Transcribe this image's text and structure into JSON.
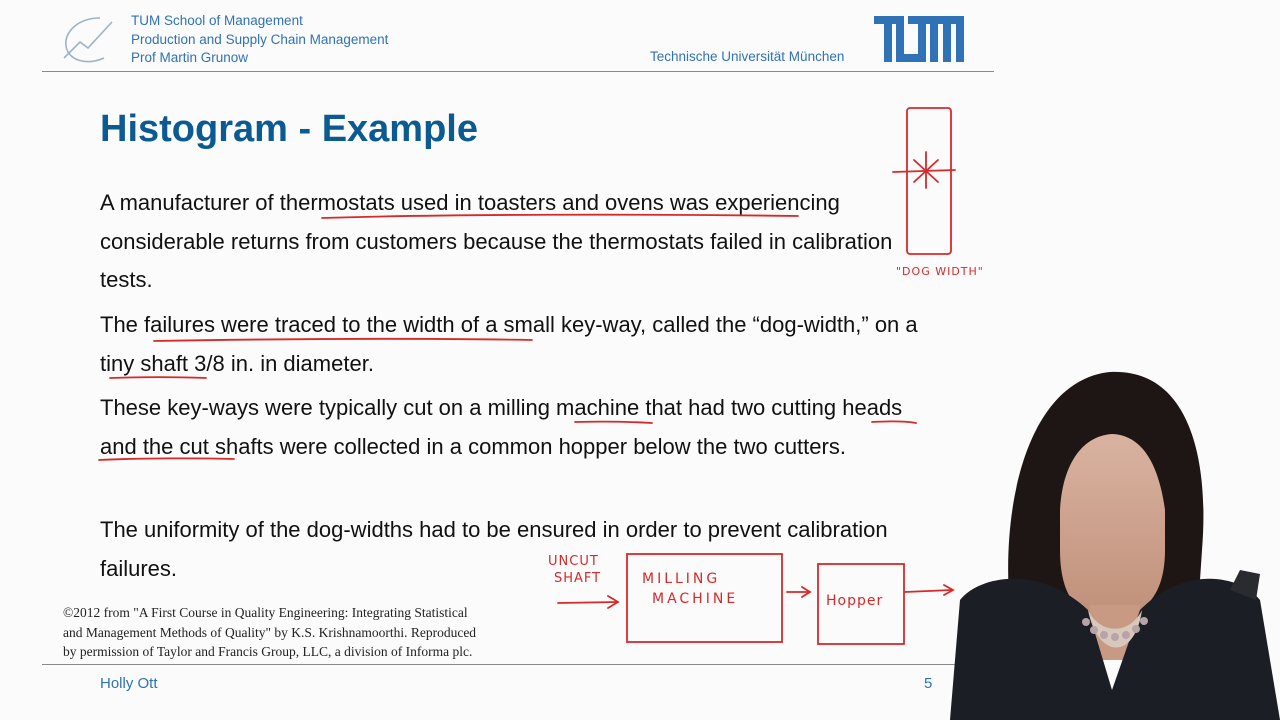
{
  "header": {
    "school": "TUM School of Management",
    "chair": "Production and Supply Chain Management",
    "professor": "Prof Martin Grunow",
    "university": "Technische Universität München",
    "logo_text": "TUM"
  },
  "slide": {
    "title": "Histogram - Example",
    "paragraphs": [
      "A manufacturer of thermostats used in toasters and ovens was experiencing considerable returns from customers because the thermostats failed in calibration tests.",
      "The failures were traced to the width of a small key-way, called the “dog-width,” on a tiny shaft 3/8 in. in diameter.",
      "These key-ways were typically cut on a milling machine that had two cutting heads and the cut shafts were collected in a common hopper below the two cutters.",
      "The uniformity of the dog-widths had to be ensured in order to prevent calibration failures."
    ],
    "credit": [
      "©2012 from \"A First Course in Quality Engineering: Integrating Statistical",
      "and Management Methods of Quality\" by K.S. Krishnamoorthi. Reproduced",
      "by permission of Taylor and Francis Group, LLC, a division of Informa plc."
    ]
  },
  "annotations": {
    "dog_width": "\"DOG WIDTH\"",
    "uncut": "UNCUT",
    "shaft": "SHAFT",
    "milling": "MILLING",
    "machine": "MACHINE",
    "hopper": "Hopper",
    "ink_color": "#d62a2a"
  },
  "footer": {
    "presenter": "Holly Ott",
    "page": "5"
  },
  "colors": {
    "accent": "#2f72b6",
    "title": "#0b5a91"
  }
}
